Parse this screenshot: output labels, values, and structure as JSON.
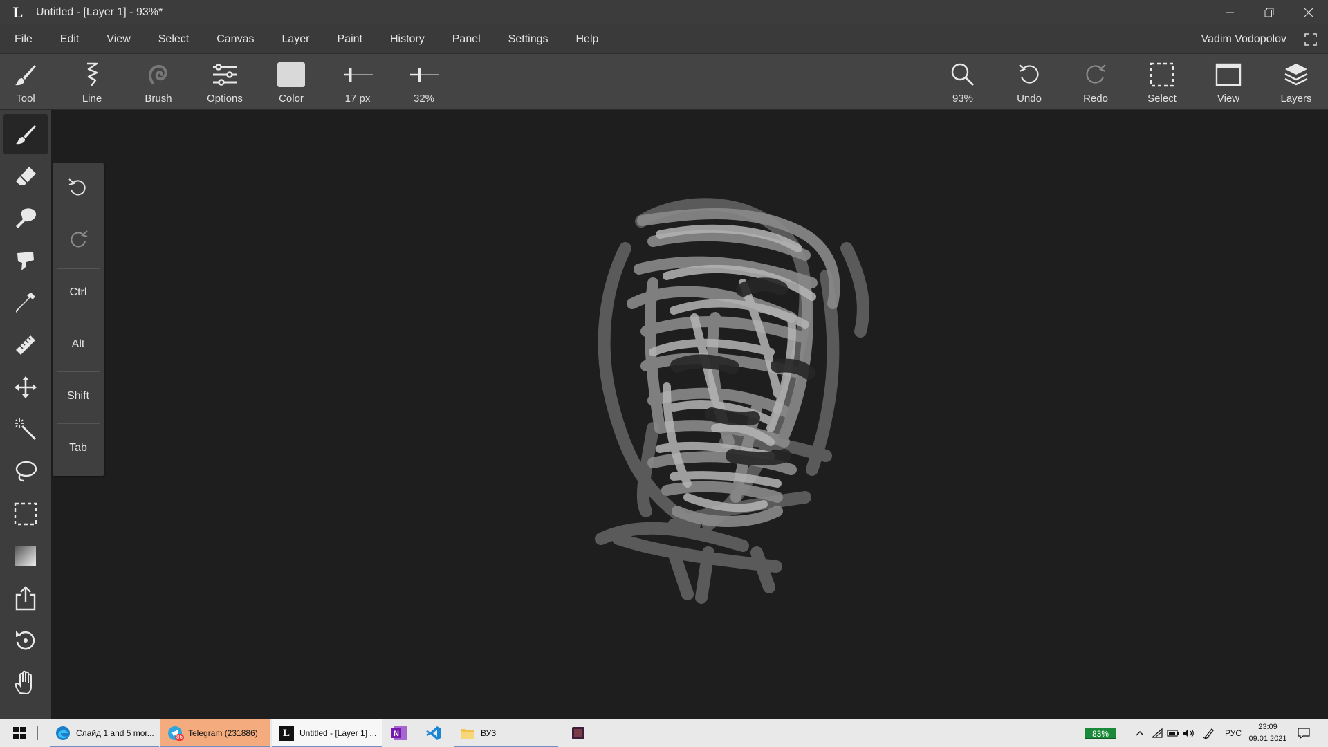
{
  "window": {
    "logo": "L",
    "title": "Untitled - [Layer 1] - 93%*"
  },
  "menu": [
    "File",
    "Edit",
    "View",
    "Select",
    "Canvas",
    "Layer",
    "Paint",
    "History",
    "Panel",
    "Settings",
    "Help"
  ],
  "user": "Vadim Vodopolov",
  "toolbar": {
    "tool": "Tool",
    "line": "Line",
    "brush": "Brush",
    "options": "Options",
    "color": "Color",
    "size": "17 px",
    "opacity": "32%",
    "zoom": "93%",
    "undo": "Undo",
    "redo": "Redo",
    "select": "Select",
    "view": "View",
    "layers": "Layers",
    "brush_color": "#d9d9d9"
  },
  "tools": [
    "brush-icon",
    "eraser-icon",
    "smudge-icon",
    "fill-icon",
    "eyedropper-icon",
    "ruler-icon",
    "move-icon",
    "magic-wand-icon",
    "lasso-icon",
    "rect-select-icon",
    "gradient-icon",
    "share-icon",
    "reset-icon",
    "hand-icon"
  ],
  "modifiers": {
    "ctrl": "Ctrl",
    "alt": "Alt",
    "shift": "Shift",
    "tab": "Tab"
  },
  "taskbar": {
    "edge": "Слайд 1 and 5 mor...",
    "telegram": "Telegram (231886)",
    "telegram_badge": "86",
    "lunacy": "Untitled - [Layer 1] ...",
    "folder": "ВУЗ",
    "battery": "83%",
    "lang": "РУС",
    "time": "23:09",
    "date": "09.01.2021"
  }
}
